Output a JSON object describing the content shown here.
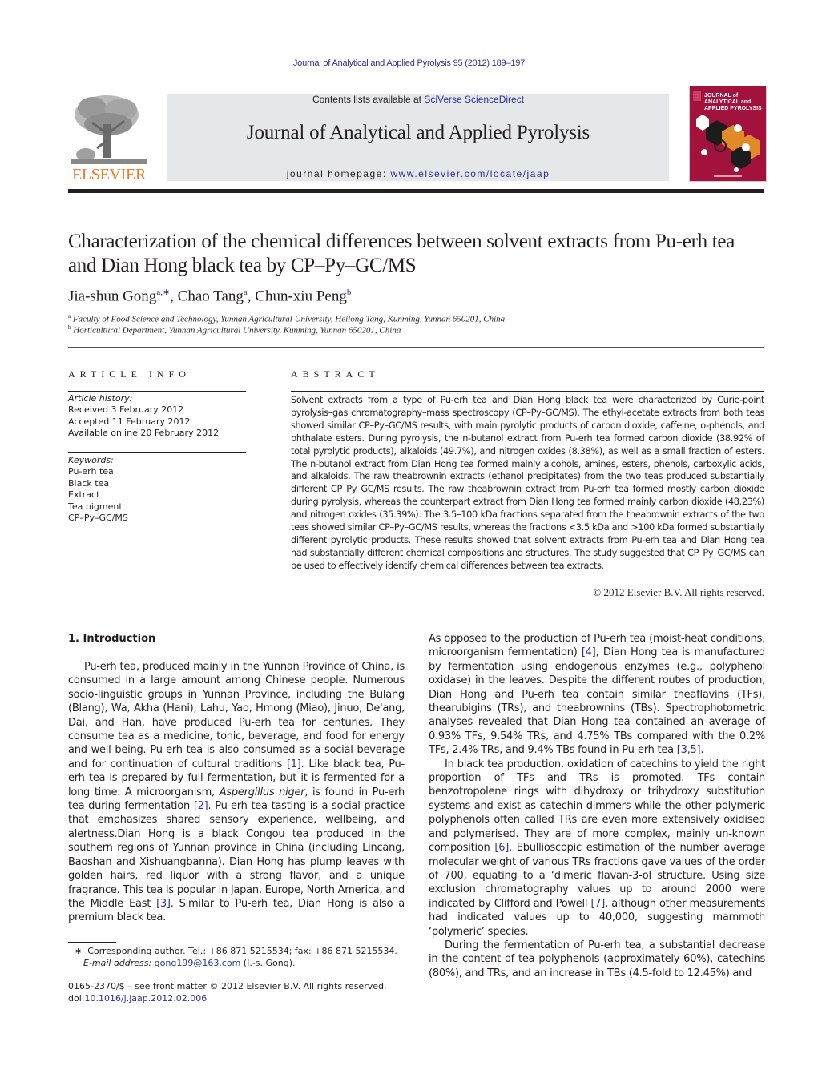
{
  "header": {
    "citation": "Journal of Analytical and Applied Pyrolysis 95 (2012) 189–197",
    "contents_prefix": "Contents lists available at ",
    "contents_link": "SciVerse ScienceDirect",
    "journal_title": "Journal of Analytical and Applied Pyrolysis",
    "homepage_prefix": "journal homepage: ",
    "homepage_link": "www.elsevier.com/locate/jaap",
    "publisher_logo_text": "ELSEVIER",
    "cover_title_lines": [
      "JOURNAL of",
      "ANALYTICAL and",
      "APPLIED PYROLYSIS"
    ]
  },
  "article": {
    "title": "Characterization of the chemical differences between solvent extracts from Pu-erh tea and Dian Hong black tea by CP–Py–GC/MS",
    "authors": [
      {
        "name": "Jia-shun Gong",
        "sup": "a,∗"
      },
      {
        "name": "Chao Tang",
        "sup": "a"
      },
      {
        "name": "Chun-xiu Peng",
        "sup": "b"
      }
    ],
    "affiliations": [
      {
        "mark": "a",
        "text": "Faculty of Food Science and Technology, Yunnan Agricultural University, Heilong Tang, Kunming, Yunnan 650201, China"
      },
      {
        "mark": "b",
        "text": "Horticultural Department, Yunnan Agricultural University, Kunming, Yunnan 650201, China"
      }
    ]
  },
  "article_info": {
    "heading": "ARTICLE INFO",
    "history_label": "Article history:",
    "history": [
      "Received 3 February 2012",
      "Accepted 11 February 2012",
      "Available online 20 February 2012"
    ],
    "keywords_label": "Keywords:",
    "keywords": [
      "Pu-erh tea",
      "Black tea",
      "Extract",
      "Tea pigment",
      "CP–Py–GC/MS"
    ]
  },
  "abstract": {
    "heading": "ABSTRACT",
    "text": "Solvent extracts from a type of Pu-erh tea and Dian Hong black tea were characterized by Curie-point pyrolysis–gas chromatography–mass spectroscopy (CP–Py–GC/MS). The ethyl-acetate extracts from both teas showed similar CP–Py–GC/MS results, with main pyrolytic products of carbon dioxide, caffeine, o-phenols, and phthalate esters. During pyrolysis, the n-butanol extract from Pu-erh tea formed carbon dioxide (38.92% of total pyrolytic products), alkaloids (49.7%), and nitrogen oxides (8.38%), as well as a small fraction of esters. The n-butanol extract from Dian Hong tea formed mainly alcohols, amines, esters, phenols, carboxylic acids, and alkaloids. The raw theabrownin extracts (ethanol precipitates) from the two teas produced substantially different CP–Py–GC/MS results. The raw theabrownin extract from Pu-erh tea formed mostly carbon dioxide during pyrolysis, whereas the counterpart extract from Dian Hong tea formed mainly carbon dioxide (48.23%) and nitrogen oxides (35.39%). The 3.5–100 kDa fractions separated from the theabrownin extracts of the two teas showed similar CP–Py–GC/MS results, whereas the fractions <3.5 kDa and >100 kDa formed substantially different pyrolytic products. These results showed that solvent extracts from Pu-erh tea and Dian Hong tea had substantially different chemical compositions and structures. The study suggested that CP–Py–GC/MS can be used to effectively identify chemical differences between tea extracts.",
    "copyright": "© 2012 Elsevier B.V. All rights reserved."
  },
  "introduction": {
    "heading": "1.  Introduction",
    "left_paragraphs": [
      {
        "parts": [
          {
            "t": "Pu-erh tea, produced mainly in the Yunnan Province of China, is consumed in a large amount among Chinese people. Numerous socio-linguistic groups in Yunnan Province, including the Bulang (Blang), Wa, Akha (Hani), Lahu, Yao, Hmong (Miao), Jinuo, De'ang, Dai, and Han, have produced Pu-erh tea for centuries. They consume tea as a medicine, tonic, beverage, and food for energy and well being. Pu-erh tea is also consumed as a social beverage and for continuation of cultural traditions "
          },
          {
            "ref": "[1]"
          },
          {
            "t": ". Like black tea, Pu-erh tea is prepared by full fermentation, but it is fermented for a long time. A microorganism, "
          },
          {
            "i": "Aspergillus niger"
          },
          {
            "t": ", is found in Pu-erh tea during fermentation "
          },
          {
            "ref": "[2]"
          },
          {
            "t": ". Pu-erh tea tasting is a social practice that emphasizes shared sensory experience, wellbeing, and alertness.Dian Hong is a black Congou tea produced in the southern regions of Yunnan province in China (including Lincang, Baoshan and Xishuangbanna). Dian Hong has plump leaves with golden hairs, red liquor with a strong flavor, and a unique fragrance. This tea is popular in Japan, Europe, North America, and the Middle East "
          },
          {
            "ref": "[3]"
          },
          {
            "t": ". Similar to Pu-erh tea, Dian Hong is also a premium black tea."
          }
        ]
      }
    ],
    "right_paragraphs": [
      {
        "noindent": true,
        "parts": [
          {
            "t": "As opposed to the production of Pu-erh tea (moist-heat conditions, microorganism fermentation) "
          },
          {
            "ref": "[4]"
          },
          {
            "t": ", Dian Hong tea is manufactured by fermentation using endogenous enzymes (e.g., polyphenol oxidase) in the leaves. Despite the different routes of production, Dian Hong and Pu-erh tea contain similar theaflavins (TFs), thearubigins (TRs), and theabrownins (TBs). Spectrophotometric analyses revealed that Dian Hong tea contained an average of 0.93% TFs, 9.54% TRs, and 4.75% TBs compared with the 0.2% TFs, 2.4% TRs, and 9.4% TBs found in Pu-erh tea "
          },
          {
            "ref": "[3,5]"
          },
          {
            "t": "."
          }
        ]
      },
      {
        "parts": [
          {
            "t": "In black tea production, oxidation of catechins to yield the right proportion of TFs and TRs is promoted. TFs contain benzotropolene rings with dihydroxy or trihydroxy substitution systems and exist as catechin dimmers while the other polymeric polyphenols often called TRs are even more extensively oxidised and polymerised. They are of more complex, mainly un-known composition "
          },
          {
            "ref": "[6]"
          },
          {
            "t": ". Ebullioscopic estimation of the number average molecular weight of various TRs fractions gave values of the order of 700, equating to a ‘dimeric flavan-3-ol structure. Using size exclusion chromatography values up to around 2000 were indicated by Clifford and Powell "
          },
          {
            "ref": "[7]"
          },
          {
            "t": ", although other measurements had indicated values up to 40,000, suggesting mammoth ‘polymeric’ species."
          }
        ]
      },
      {
        "parts": [
          {
            "t": "During the fermentation of Pu-erh tea, a substantial decrease in the content of tea polyphenols (approximately 60%), catechins (80%), and TRs, and an increase in TBs (4.5-fold to 12.45%) and"
          }
        ]
      }
    ]
  },
  "footnotes": {
    "marker": "∗",
    "corresponding": "Corresponding author. Tel.: +86 871 5215534; fax: +86 871 5215534.",
    "email_label": "E-mail address:",
    "email": "gong199@163.com",
    "email_suffix": " (J.-s. Gong).",
    "issn_line": "0165-2370/$ – see front matter © 2012 Elsevier B.V. All rights reserved.",
    "doi_prefix": "doi:",
    "doi": "10.1016/j.jaap.2012.02.006"
  },
  "colors": {
    "link": "#2e3192",
    "elsevier_orange": "#f47920",
    "masthead_gray": "#e6e7e8",
    "cover_red": "#a3123c",
    "cover_orange": "#e08a2a"
  }
}
